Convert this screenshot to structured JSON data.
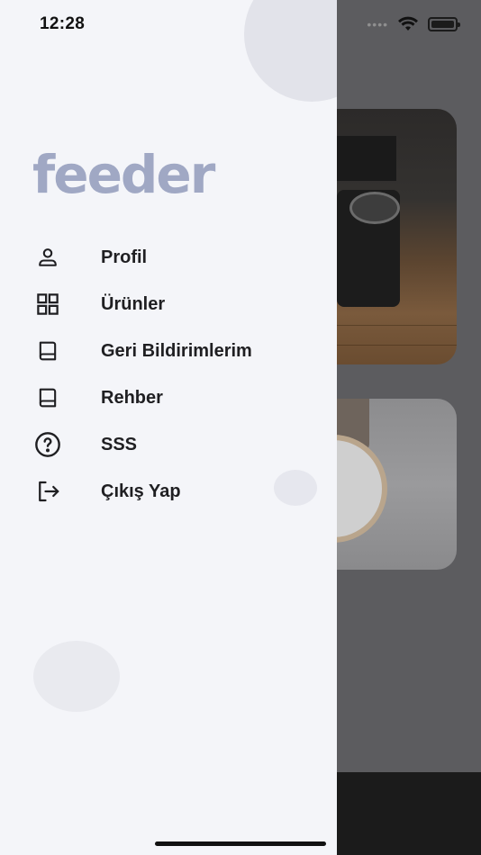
{
  "status_bar": {
    "time": "12:28"
  },
  "drawer": {
    "logo": "feeder",
    "menu": [
      {
        "label": "Profil",
        "icon": "person-icon"
      },
      {
        "label": "Ürünler",
        "icon": "grid-icon"
      },
      {
        "label": "Geri Bildirimlerim",
        "icon": "book-icon"
      },
      {
        "label": "Rehber",
        "icon": "book-icon"
      },
      {
        "label": "SSS",
        "icon": "help-circle-icon"
      },
      {
        "label": "Çıkış Yap",
        "icon": "logout-icon"
      }
    ]
  },
  "colors": {
    "drawer_bg": "#f4f5f9",
    "logo": "#a0a8c4",
    "label": "#1f1f22",
    "overlay": "#5c5c5f"
  }
}
